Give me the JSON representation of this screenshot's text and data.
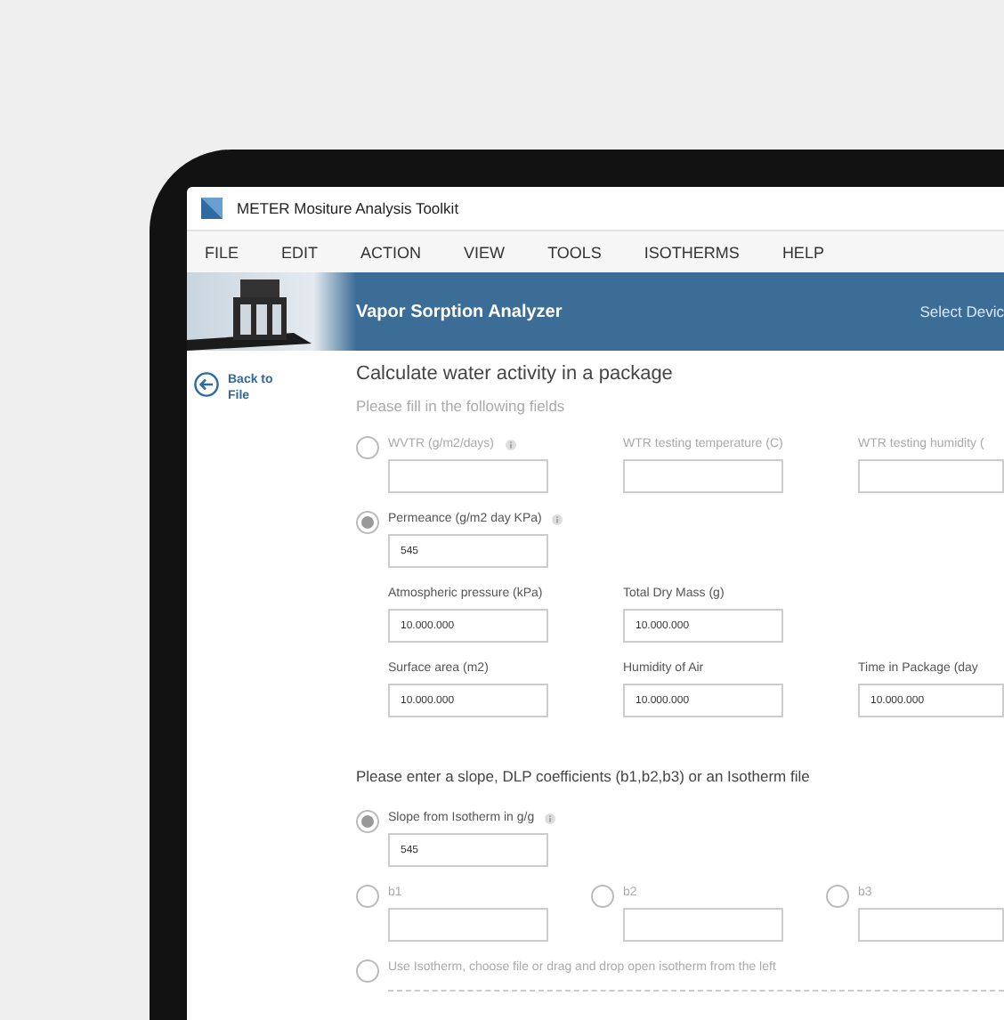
{
  "window": {
    "title": "METER Mositure Analysis Toolkit"
  },
  "menu": [
    "FILE",
    "EDIT",
    "ACTION",
    "VIEW",
    "TOOLS",
    "ISOTHERMS",
    "HELP"
  ],
  "banner": {
    "title": "Vapor Sorption Analyzer",
    "action": "Select Devic"
  },
  "back_link": "Back to File",
  "form": {
    "title": "Calculate water activity in a package",
    "subtitle": "Please fill in the following fields",
    "options": [
      {
        "label": "WVTR (g/m2/days)",
        "selected": false,
        "info": true,
        "related_fields": [
          {
            "label": "WTR testing temperature (C)"
          },
          {
            "label": "WTR testing humidity ("
          }
        ]
      },
      {
        "label": "Permeance (g/m2 day KPa)",
        "selected": true,
        "info": true,
        "value": "545"
      }
    ],
    "fields": [
      [
        {
          "label": "Atmospheric pressure (kPa)",
          "value": "10.000.000"
        },
        {
          "label": "Total Dry Mass (g)",
          "value": "10.000.000"
        }
      ],
      [
        {
          "label": "Surface area (m2)",
          "value": "10.000.000"
        },
        {
          "label": "Humidity of Air",
          "value": "10.000.000"
        },
        {
          "label": "Time in Package (day",
          "value": "10.000.000"
        }
      ]
    ]
  },
  "section2": {
    "title": "Please enter a slope, DLP coefficients (b1,b2,b3) or an Isotherm file",
    "slope": {
      "label": "Slope from Isotherm in g/g",
      "selected": true,
      "info": true,
      "value": "545"
    },
    "coefficients": [
      {
        "label": "b1",
        "selected": false
      },
      {
        "label": "b2",
        "selected": false
      },
      {
        "label": "b3",
        "selected": false
      }
    ],
    "isotherm": {
      "label": "Use Isotherm, choose file or drag and drop open isotherm from the left",
      "selected": false
    }
  }
}
